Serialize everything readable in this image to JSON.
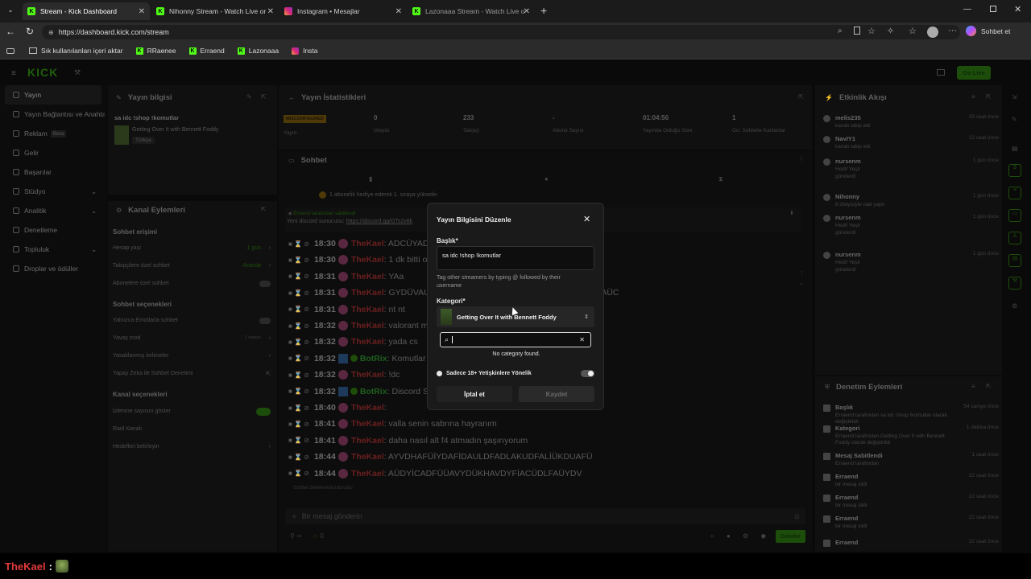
{
  "browser": {
    "tabs": [
      {
        "title": "Stream - Kick Dashboard",
        "active": true
      },
      {
        "title": "Nihonny Stream - Watch Live on K"
      },
      {
        "title": "Instagram • Mesajlar"
      },
      {
        "title": "Lazonaaa Stream - Watch Live on"
      }
    ],
    "url": "https://dashboard.kick.com/stream",
    "copilot_label": "Sohbet et",
    "bookmarks": [
      "Sık kullanılanları içeri aktar",
      "RRaenee",
      "Erraend",
      "Lazonaaa",
      "Insta"
    ]
  },
  "topbar": {
    "logo": "KICK",
    "go_live": "Go Live"
  },
  "sidebar": {
    "items": [
      "Yayın",
      "Yayın Bağlantısı ve Anahtarı",
      "Reklam",
      "Gelir",
      "Başarılar",
      "Stüdyo",
      "Analitik",
      "Denetleme",
      "Topluluk",
      "Droplar ve ödüller"
    ],
    "reklam_badge": "Beta"
  },
  "stream_info": {
    "header": "Yayın bilgisi",
    "title": "sa idc !shop !komutlar",
    "category": "Getting Over It with Bennett Foddy",
    "language": "Türkçe"
  },
  "channel_actions": {
    "header": "Kanal Eylemleri",
    "chat_access": "Sohbet erişimi",
    "rows1": [
      {
        "label": "Hesap yaşı",
        "value": "1 gün"
      },
      {
        "label": "Takipçilere özel sohbet",
        "value": "Aranda"
      },
      {
        "label": "Abonelere özel sohbet",
        "value": ""
      }
    ],
    "chat_options": "Sohbet seçenekleri",
    "rows2": [
      "Yalnızca Emotlarla sohbet",
      "Yavaş mod",
      "Yasaklanmış kelimeler",
      "Yapay Zeka ile Sohbet Denetimi"
    ],
    "slow_value": "1 saniye",
    "channel_options": "Kanal seçenekleri",
    "rows3": [
      "İzlenme sayısını göster",
      "Raid Kanalı",
      "Hedefleri belirleyin"
    ]
  },
  "stats": {
    "header": "Yayın İstatistikleri",
    "status_badge": "MISCONFIGURED",
    "items": [
      {
        "value": "",
        "label": "Yayın"
      },
      {
        "value": "0",
        "label": "İzleyici"
      },
      {
        "value": "233",
        "label": "Takipçi"
      },
      {
        "value": "-",
        "label": "Abone Sayısı"
      },
      {
        "value": "01:04:56",
        "label": "Yayında Olduğu Süre"
      },
      {
        "value": "1",
        "label": "Ort. Sohbete Katılanlar"
      }
    ]
  },
  "chat": {
    "header": "Sohbet",
    "gift_banner": "1 abonelik hediye ederek 1. sıraya yükselin",
    "pinned_by": "Erraend tarafından sabitlendi",
    "pinned_text": "Yeni discord sunucusu:",
    "pinned_link": "https://discord.gg/GTs2v8k",
    "messages": [
      {
        "time": "18:30",
        "user": "TheKael",
        "text": ": ADCÜYADF"
      },
      {
        "time": "18:30",
        "user": "TheKael",
        "text": ": 1 dk bitti oyun"
      },
      {
        "time": "18:31",
        "user": "TheKael",
        "text": ": YAa"
      },
      {
        "time": "18:31",
        "user": "TheKael",
        "text": ": GYDÜVAUDF",
        "tail": "DİFAÜC"
      },
      {
        "time": "18:31",
        "user": "TheKael",
        "text": ": nt nt"
      },
      {
        "time": "18:32",
        "user": "TheKael",
        "text": ": valorant m"
      },
      {
        "time": "18:32",
        "user": "TheKael",
        "text": ": yada cs"
      },
      {
        "time": "18:32",
        "user": "BotRix",
        "text": ": Komutlar",
        "bot": true
      },
      {
        "time": "18:32",
        "user": "TheKael",
        "text": ": !dc"
      },
      {
        "time": "18:32",
        "user": "BotRix",
        "text": ": Discord S",
        "bot": true
      },
      {
        "time": "18:40",
        "user": "TheKael",
        "text": ":"
      },
      {
        "time": "18:41",
        "user": "TheKael",
        "text": ": valla senin sabrına hayranım"
      },
      {
        "time": "18:41",
        "user": "TheKael",
        "text": ": daha nasıl alt f4 atmadın şaşırıyorum"
      },
      {
        "time": "18:44",
        "user": "TheKael",
        "text": ": AYVDHAFÜİYDAFİDAULDFADLAKUDFALİÜKDUAFÜ"
      },
      {
        "time": "18:44",
        "user": "TheKael",
        "text": ": AÜDYİCADFÜÜAVYDÜKHAVDYFİACÜDLFAÜYDV"
      }
    ],
    "paused": "Sohbet bekleme/durduruldu",
    "input_placeholder": "Bir mesaj gönderin",
    "footer_left": "∞",
    "footer_count": "0",
    "send_label": "Gönder"
  },
  "activity": {
    "header": "Etkinlik Akışı",
    "items": [
      {
        "name": "melis235",
        "sub": "kanalı takip etti",
        "time": "29 saat önce"
      },
      {
        "name": "NavIY1",
        "sub": "kanalı takip etti",
        "time": "22 saat önce"
      },
      {
        "name": "nursenm",
        "sub": "Hedif Yeşil",
        "extra": "gönderdi",
        "time": "1 gün önce"
      },
      {
        "name": "Nihonny",
        "sub": "8 izleyiciyle raid yaptı",
        "time": "1 gün önce"
      },
      {
        "name": "nursenm",
        "sub": "Hedif Yeşil",
        "extra": "gönderdi",
        "time": "1 gün önce"
      },
      {
        "name": "nursenm",
        "sub": "Hedif Yeşil",
        "extra": "gönderdi",
        "time": "1 gün önce"
      }
    ]
  },
  "moderation": {
    "header": "Denetim Eylemleri",
    "items": [
      {
        "name": "Başlık",
        "sub": "Erraend tarafından sa idc !shop !komutlar olarak değiştirildi",
        "time": "54 saniye önce"
      },
      {
        "name": "Kategori",
        "sub": "Erraend tarafından Getting Over It with Bennett Foddy olarak değiştirildi",
        "time": "1 dakika önce"
      },
      {
        "name": "Mesaj Sabitlendi",
        "sub": "Erraend tarafından",
        "time": "1 saat önce"
      },
      {
        "name": "Erraend",
        "sub": "bir mesaj sildi",
        "time": "22 saat önce"
      },
      {
        "name": "Erraend",
        "sub": "bir mesaj sildi",
        "time": "22 saat önce"
      },
      {
        "name": "Erraend",
        "sub": "bir mesaj sildi",
        "time": "22 saat önce"
      },
      {
        "name": "Erraend",
        "sub": "",
        "time": "22 saat önce"
      }
    ]
  },
  "modal": {
    "title": "Yayın Bilgisini Düzenle",
    "title_label": "Başlık*",
    "title_value": "sa idc !shop !komutlar",
    "tag_hint": "Tag other streamers by typing @ followed by their username",
    "category_label": "Kategori*",
    "category_value": "Getting Over It with Bennett Foddy",
    "search_value": "",
    "no_results": "No category found.",
    "adult_label": "Sadece 18+ Yetişkinlere Yönelik",
    "cancel": "İptal et",
    "save": "Kaydet"
  },
  "overlay": {
    "user": "TheKael",
    "sep": ":"
  },
  "colors": {
    "kick_green": "#53fc18",
    "red_user": "#e23a3a"
  }
}
